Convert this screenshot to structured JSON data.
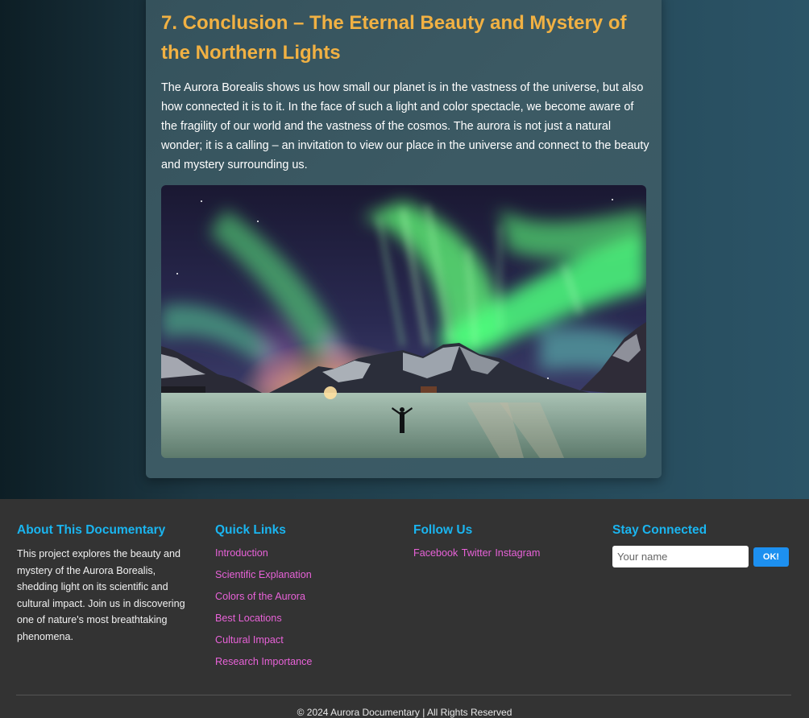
{
  "article": {
    "heading": "7. Conclusion – The Eternal Beauty and Mystery of the Northern Lights",
    "body": "The Aurora Borealis shows us how small our planet is in the vastness of the universe, but also how connected it is to it. In the face of such a light and color spectacle, we become aware of the fragility of our world and the vastness of the cosmos. The aurora is not just a natural wonder; it is a calling – an invitation to view our place in the universe and connect to the beauty and mystery surrounding us."
  },
  "footer": {
    "about": {
      "title": "About This Documentary",
      "text": "This project explores the beauty and mystery of the Aurora Borealis, shedding light on its scientific and cultural impact. Join us in discovering one of nature's most breathtaking phenomena."
    },
    "quick_links": {
      "title": "Quick Links",
      "items": [
        "Introduction",
        "Scientific Explanation",
        "Colors of the Aurora",
        "Best Locations",
        "Cultural Impact",
        "Research Importance"
      ]
    },
    "follow": {
      "title": "Follow Us",
      "links": [
        "Facebook",
        "Twitter",
        "Instagram"
      ]
    },
    "connect": {
      "title": "Stay Connected",
      "placeholder": "Your name",
      "button_label": "OK!"
    },
    "copyright": "© 2024 Aurora Documentary | All Rights Reserved"
  },
  "colors": {
    "heading": "#f1b143",
    "footer_heading": "#1ab5f0",
    "link": "#e862d8",
    "button": "#1d90f0",
    "footer_bg": "#333333"
  }
}
